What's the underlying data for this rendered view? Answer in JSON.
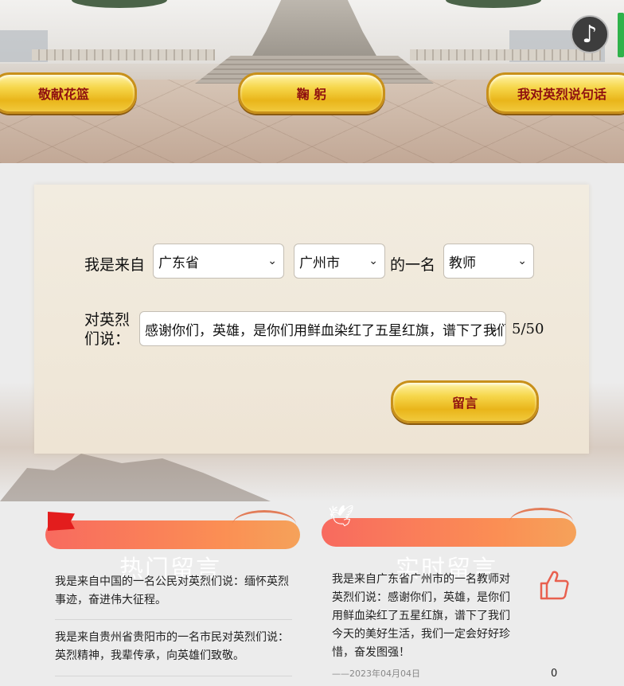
{
  "nav": {
    "basket_label": "敬献花篮",
    "bow_label": "鞠 躬",
    "say_label": "我对英烈说句话"
  },
  "icons": {
    "music": "music-note-icon",
    "like": "thumbs-up-icon"
  },
  "form": {
    "prefix": "我是来自",
    "province": "广东省",
    "city": "广州市",
    "middle": "的一名",
    "role": "教师",
    "say_label": "对英烈们说：",
    "message": "感谢你们，英雄，是你们用鲜血染红了五星红旗，谱下了我们今天的美好生活，我们一定会好好珍惜，奋发图强！",
    "counter": "5/50",
    "submit_label": "留言"
  },
  "hot": {
    "title": "热门留言",
    "items": [
      "我是来自中国的一名公民对英烈们说：缅怀英烈事迹，奋进伟大征程。",
      "我是来自贵州省贵阳市的一名市民对英烈们说：英烈精神，我辈传承，向英雄们致敬。"
    ]
  },
  "live": {
    "title": "实时留言",
    "item": {
      "text": "我是来自广东省广州市的一名教师对英烈们说：感谢你们，英雄，是你们用鲜血染红了五星红旗，谱下了我们今天的美好生活，我们一定会好好珍惜，奋发图强！",
      "date": "——2023年04月04日",
      "likes": "0"
    }
  },
  "colors": {
    "gold": "#f6d64a",
    "button_text": "#8f1010",
    "title_bar": "#f86a5f"
  }
}
